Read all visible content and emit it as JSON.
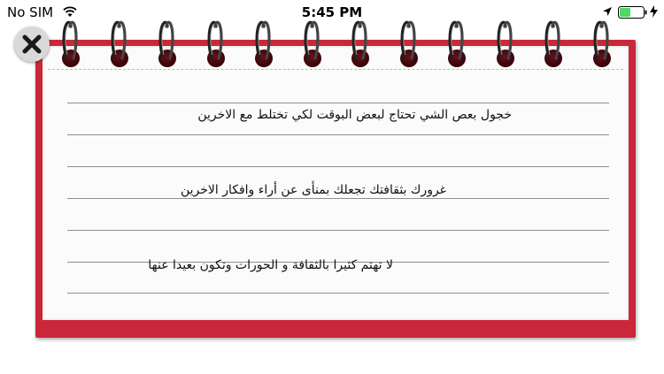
{
  "status_bar": {
    "carrier": "No SIM",
    "time": "5:45 PM",
    "icons": [
      "wifi-icon",
      "location-icon",
      "battery-icon",
      "charging-icon"
    ]
  },
  "notes": [
    "خجول بعص الشي تحتاج لبعض البوقت لكي تختلط مع الاخرين",
    "غرورك بثقافتك تجعلك بمنأى عن أراء وافكار الاخرين",
    "لا تهتم كثيرا بالثقافة و الحورات وتكون بعيدا عنها"
  ],
  "colors": {
    "notepad_cover": "#c9283a",
    "paper": "#fbfbfb",
    "rule_line": "#8f8f8f"
  },
  "close_button": {
    "icon": "close-icon"
  }
}
